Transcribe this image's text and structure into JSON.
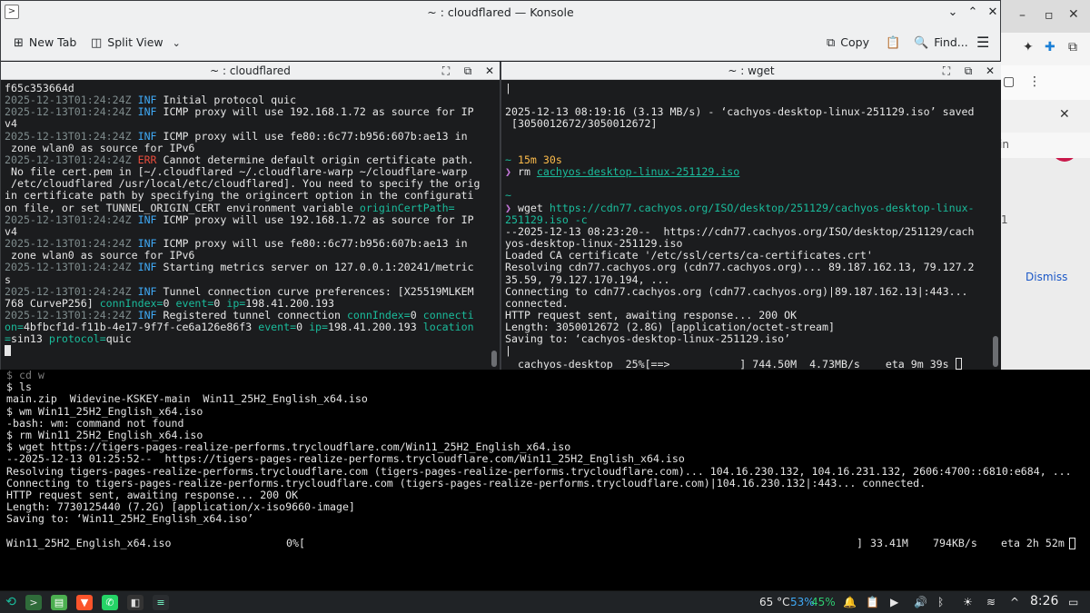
{
  "window": {
    "title": "~ : cloudflared — Konsole"
  },
  "toolbar": {
    "new_tab": "New Tab",
    "split_view": "Split View",
    "copy": "Copy",
    "find": "Find..."
  },
  "left_pane": {
    "title": "~ : cloudflared"
  },
  "right_pane": {
    "title": "~ : wget",
    "progress_name": "cachyos-desktop",
    "progress_pct": "25%[==>",
    "progress_end": "] 744.50M  4.73MB/s    eta 9m 39s"
  },
  "background_terminal": {
    "lines": [
      "$ cd w",
      "$ ls",
      "main.zip  Widevine-KSKEY-main  Win11_25H2_English_x64.iso",
      "$ wm Win11_25H2_English_x64.iso",
      "-bash: wm: command not found",
      "$ rm Win11_25H2_English_x64.iso",
      "$ wget https://tigers-pages-realize-performs.trycloudflare.com/Win11_25H2_English_x64.iso",
      "--2025-12-13 01:25:52--  https://tigers-pages-realize-performs.trycloudflare.com/Win11_25H2_English_x64.iso",
      "Resolving tigers-pages-realize-performs.trycloudflare.com (tigers-pages-realize-performs.trycloudflare.com)... 104.16.230.132, 104.16.231.132, 2606:4700::6810:e684, ...",
      "Connecting to tigers-pages-realize-performs.trycloudflare.com (tigers-pages-realize-performs.trycloudflare.com)|104.16.230.132|:443... connected.",
      "HTTP request sent, awaiting response... 200 OK",
      "Length: 7730125440 (7.2G) [application/x-iso9660-image]",
      "Saving to: ‘Win11_25H2_English_x64.iso’"
    ],
    "progress_file": "Win11_25H2_English_x64.iso",
    "progress_pct": "0%[",
    "progress_bracket": "]",
    "progress_size": "33.41M",
    "progress_speed": "794KB/s",
    "progress_eta": "eta 2h 52m"
  },
  "browser_bg": {
    "dismiss": "Dismiss",
    "avatar": "U",
    "partial": "in",
    "partial_num": "1"
  },
  "taskbar": {
    "temp": "65 °C",
    "cpu": "53%",
    "mem": "45%",
    "clock": "8:26"
  },
  "colors": {
    "accent": "#3fa9f5",
    "error": "#e74c3c",
    "key": "#1abc9c",
    "prompt_time": "#fdbc4b"
  }
}
